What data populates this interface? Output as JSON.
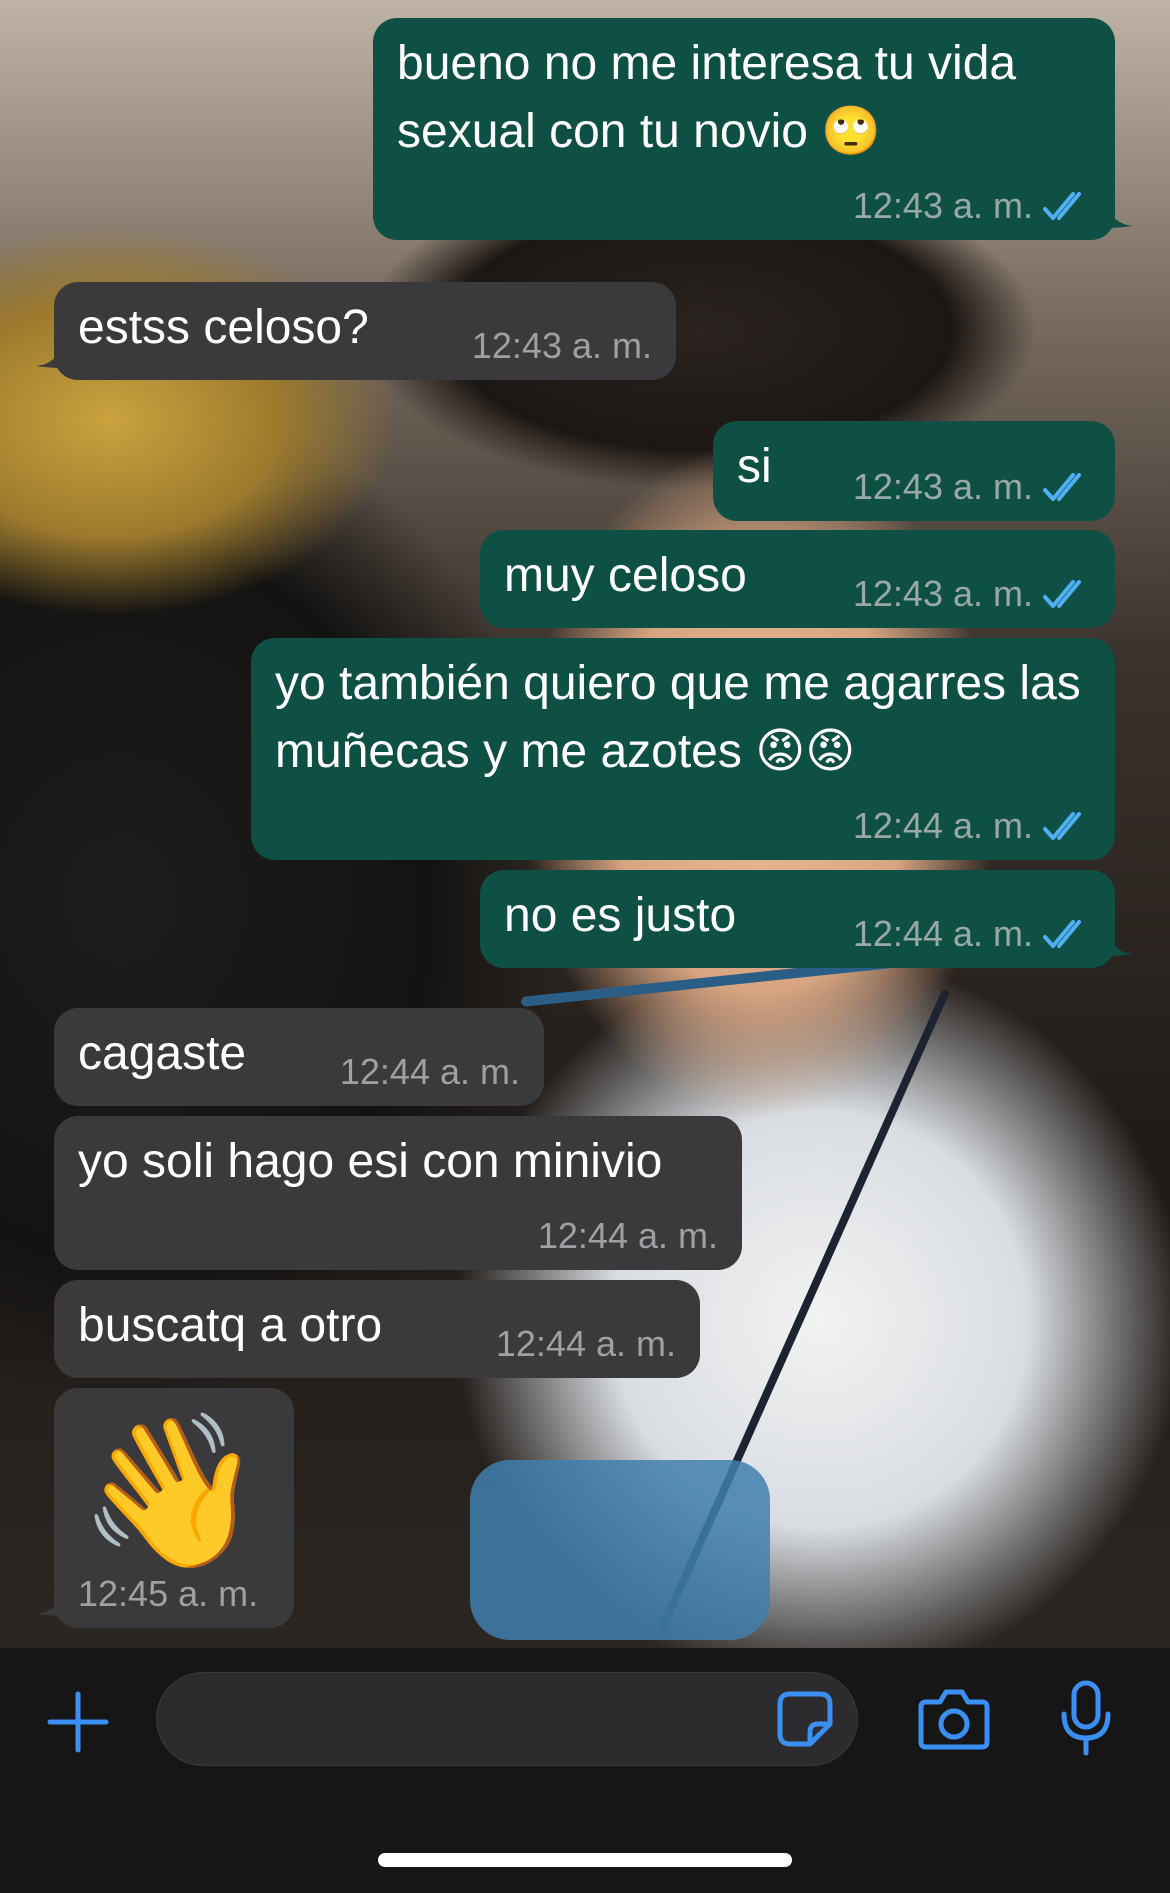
{
  "colors": {
    "outgoing_bubble": "#0f5045",
    "incoming_bubble": "#3a3a3c",
    "read_ticks": "#4fb0f5",
    "accent_icons": "#3b8ff3",
    "input_bar": "#161617"
  },
  "messages": [
    {
      "direction": "out",
      "text": "bueno no me interesa tu vida sexual con tu novio 🙄",
      "time": "12:43 a. m.",
      "read": true
    },
    {
      "direction": "in",
      "text": "estss celoso?",
      "time": "12:43 a. m."
    },
    {
      "direction": "out",
      "text": "si",
      "time": "12:43 a. m.",
      "read": true
    },
    {
      "direction": "out",
      "text": "muy celoso",
      "time": "12:43 a. m.",
      "read": true
    },
    {
      "direction": "out",
      "text": "yo también quiero que me agarres las muñecas y me azotes 😡😡",
      "time": "12:44 a. m.",
      "read": true
    },
    {
      "direction": "out",
      "text": "no es justo",
      "time": "12:44 a. m.",
      "read": true
    },
    {
      "direction": "in",
      "text": "cagaste",
      "time": "12:44 a. m."
    },
    {
      "direction": "in",
      "text": "yo soli hago esi con minivio",
      "time": "12:44 a. m."
    },
    {
      "direction": "in",
      "text": "buscatq a otro",
      "time": "12:44 a. m."
    },
    {
      "direction": "in",
      "text": "👋",
      "time": "12:45 a. m."
    }
  ],
  "input_bar": {
    "placeholder": "",
    "icons": [
      "plus-icon",
      "sticker-icon",
      "camera-icon",
      "microphone-icon"
    ]
  }
}
